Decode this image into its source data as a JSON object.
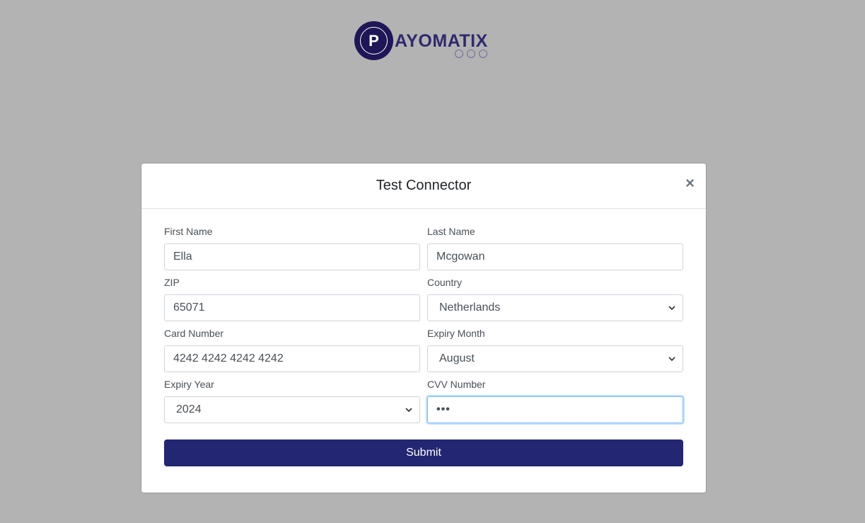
{
  "brand": {
    "logo_letter": "P",
    "logo_text": "AYOMATIX"
  },
  "modal": {
    "title": "Test Connector",
    "close_symbol": "×"
  },
  "form": {
    "first_name": {
      "label": "First Name",
      "value": "Ella"
    },
    "last_name": {
      "label": "Last Name",
      "value": "Mcgowan"
    },
    "zip": {
      "label": "ZIP",
      "value": "65071"
    },
    "country": {
      "label": "Country",
      "value": "Netherlands"
    },
    "card_number": {
      "label": "Card Number",
      "value": "4242 4242 4242 4242"
    },
    "expiry_month": {
      "label": "Expiry Month",
      "value": "August"
    },
    "expiry_year": {
      "label": "Expiry Year",
      "value": "2024"
    },
    "cvv": {
      "label": "CVV Number",
      "value": "•••"
    },
    "submit_label": "Submit"
  },
  "colors": {
    "background": "#b3b3b3",
    "brand": "#1e1656",
    "submit": "#232672"
  }
}
